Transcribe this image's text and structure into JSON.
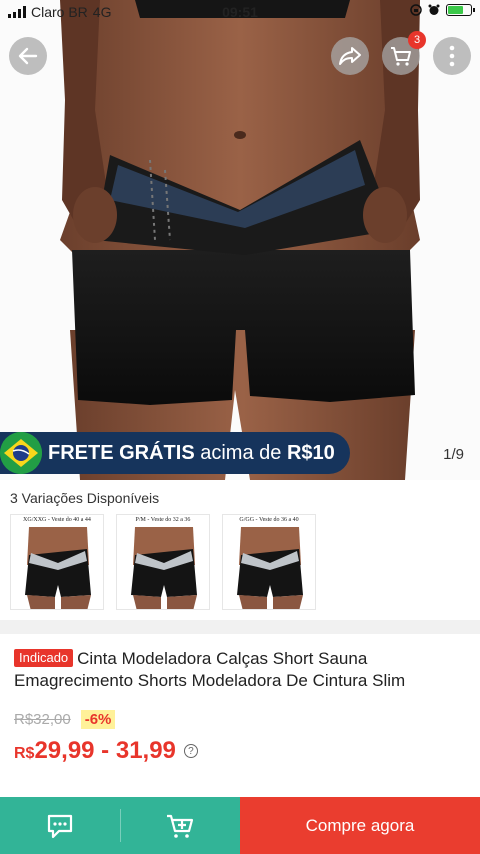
{
  "status_bar": {
    "carrier": "Claro BR",
    "network": "4G",
    "time": "09:51"
  },
  "nav": {
    "cart_count": "3"
  },
  "banner": {
    "strong": "FRETE GRÁTIS",
    "rest": "acima de",
    "amount": "R$10"
  },
  "gallery": {
    "pager": "1/9"
  },
  "variations": {
    "title": "3 Variações Disponíveis",
    "items": [
      {
        "caption": "XG/XXG - Veste do 40 a 44"
      },
      {
        "caption": "P/M - Veste do 32 a 36"
      },
      {
        "caption": "G/GG - Veste do 36 a 40"
      }
    ]
  },
  "product": {
    "badge": "Indicado",
    "title": "Cinta Modeladora Calças Short Sauna Emagrecimento Shorts Modeladora De Cintura Slim",
    "old_price": "R$32,00",
    "discount": "-6%",
    "currency": "R$",
    "price_range": "29,99 - 31,99",
    "help": "?"
  },
  "bottom_bar": {
    "buy_label": "Compre agora"
  },
  "colors": {
    "accent_red": "#ea3d2f",
    "accent_green": "#32b497",
    "banner_blue": "#16345c"
  }
}
